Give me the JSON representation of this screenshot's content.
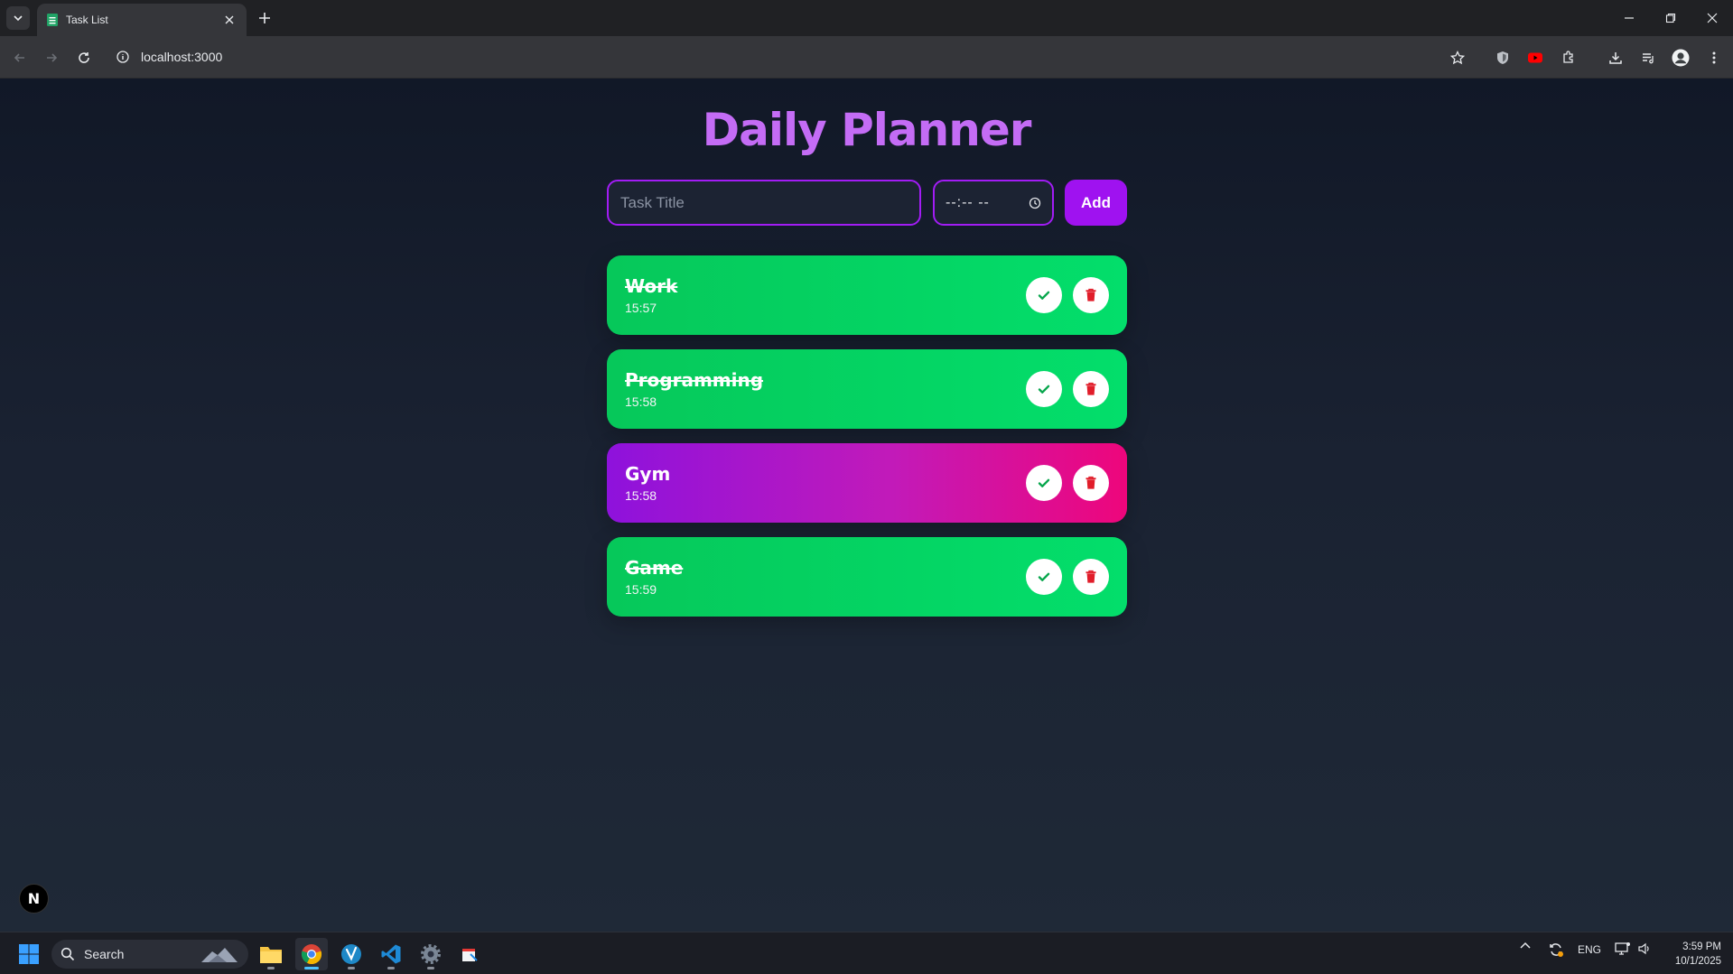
{
  "browser": {
    "tab_title": "Task List",
    "url": "localhost:3000"
  },
  "app": {
    "title": "Daily Planner",
    "task_input_placeholder": "Task Title",
    "time_input_value": "--:-- --",
    "add_label": "Add"
  },
  "tasks": [
    {
      "title": "Work",
      "time": "15:57",
      "completed": true
    },
    {
      "title": "Programming",
      "time": "15:58",
      "completed": true
    },
    {
      "title": "Gym",
      "time": "15:58",
      "completed": false
    },
    {
      "title": "Game",
      "time": "15:59",
      "completed": true
    }
  ],
  "nextjs_badge": "N",
  "taskbar": {
    "search_label": "Search",
    "language": "ENG",
    "time": "3:59 PM",
    "date": "10/1/2025"
  },
  "colors": {
    "accent": "#9f12f0",
    "heading": "#c46cf5",
    "completed": "#03de6b",
    "pending_start": "#8e12dc",
    "pending_end": "#ee067b",
    "delete_icon": "#e11d2a"
  }
}
